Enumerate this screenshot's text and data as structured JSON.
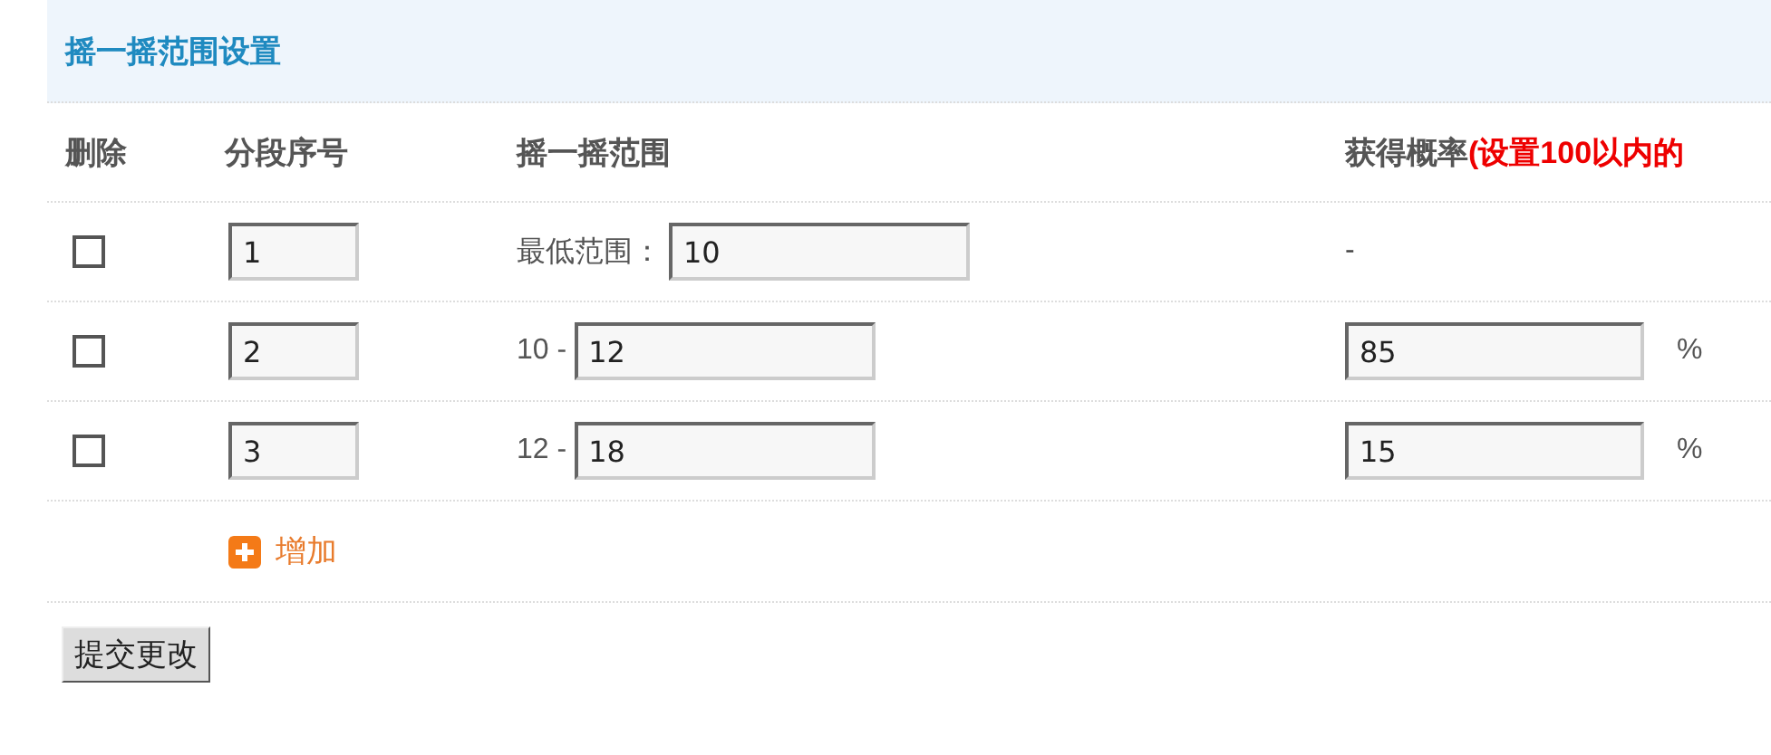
{
  "panel": {
    "title": "摇一摇范围设置"
  },
  "columns": [
    {
      "label": "删除"
    },
    {
      "label": "分段序号"
    },
    {
      "label": "摇一摇范围"
    },
    {
      "label": "获得概率",
      "hint": "(设置100以内的"
    }
  ],
  "rows": [
    {
      "kind": "min",
      "checked": false,
      "index": "1",
      "range_label": "最低范围：",
      "range_value": "10",
      "probability": "-"
    },
    {
      "kind": "range",
      "checked": false,
      "index": "2",
      "range_label": "10 -",
      "range_value": "12",
      "probability": "85",
      "unit": "%"
    },
    {
      "kind": "range",
      "checked": false,
      "index": "3",
      "range_label": "12 -",
      "range_value": "18",
      "probability": "15",
      "unit": "%"
    }
  ],
  "add_link": "增加",
  "submit_button": "提交更改"
}
